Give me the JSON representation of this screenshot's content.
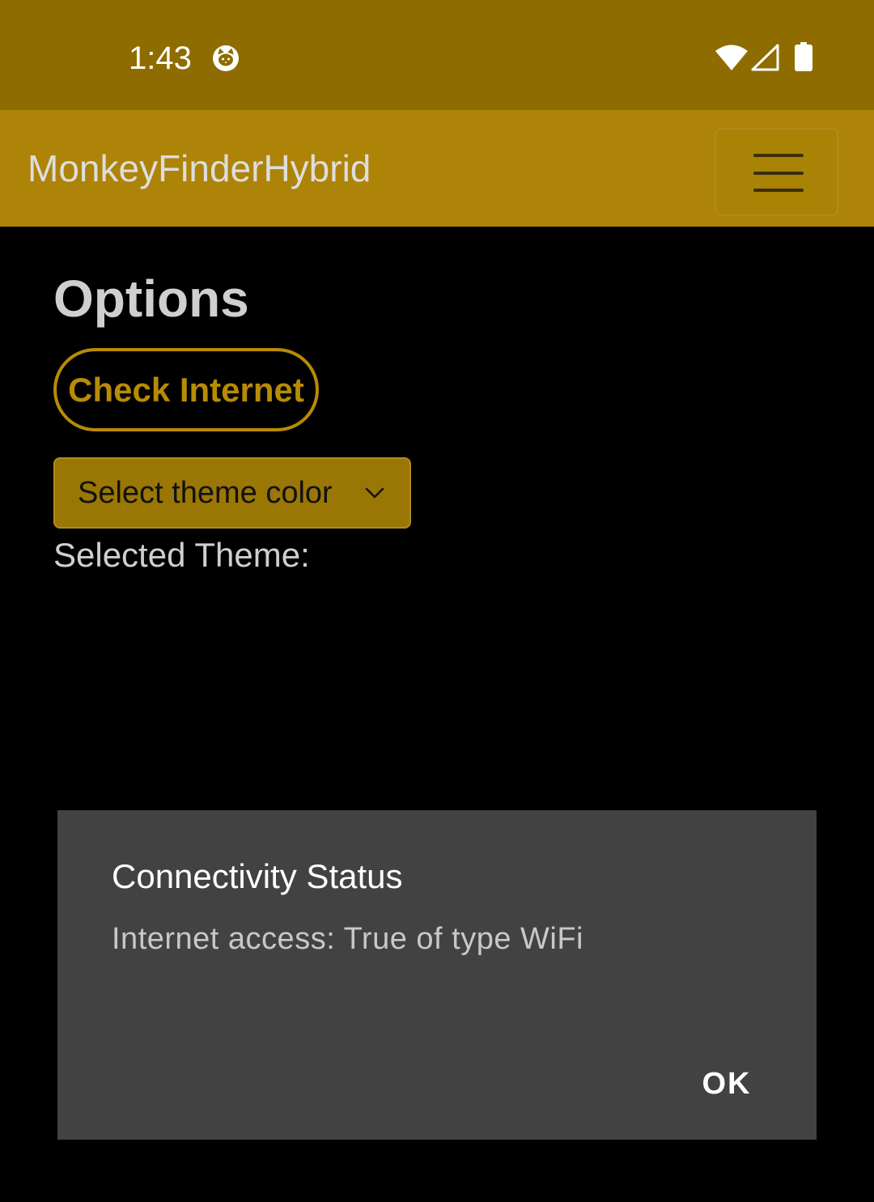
{
  "status_bar": {
    "time": "1:43",
    "app_icon": "cat-face-icon",
    "wifi_icon": "wifi-icon",
    "signal_icon": "cell-signal-icon",
    "battery_icon": "battery-icon",
    "background_color": "#8f6c00"
  },
  "app_bar": {
    "title": "MonkeyFinderHybrid",
    "menu_icon": "hamburger-menu-icon",
    "background_color": "#ad8407"
  },
  "page": {
    "title": "Options",
    "check_internet_label": "Check Internet",
    "theme_select": {
      "selected_label": "Select theme color",
      "chevron_icon": "chevron-down-icon"
    },
    "selected_theme_label": "Selected Theme:"
  },
  "dialog": {
    "title": "Connectivity Status",
    "message": "Internet access: True of type WiFi",
    "ok_label": "OK",
    "background_color": "#424242"
  },
  "colors": {
    "accent": "#b88b05",
    "background": "#000000"
  }
}
